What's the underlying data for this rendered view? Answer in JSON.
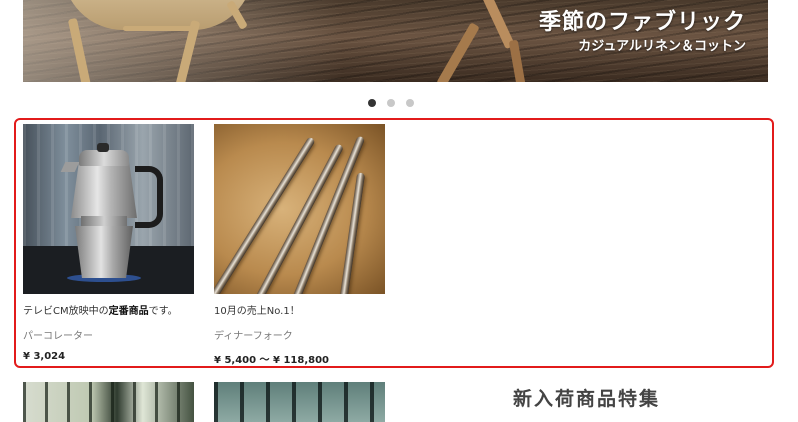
{
  "banner": {
    "title": "季節のファブリック",
    "subtitle": "カジュアルリネン＆コットン"
  },
  "carousel": {
    "slide_count": 3,
    "active_index": 0
  },
  "featured": {
    "products": [
      {
        "catch_plain": "テレビCM放映中の",
        "catch_bold": "定番商品",
        "catch_end": "です。",
        "name": "パーコレーター",
        "price": "¥ 3,024",
        "image_icon": "moka-pot-photo"
      },
      {
        "catch_plain": "10月の売上No.1！",
        "name": "ディナーフォーク",
        "price": "¥ 5,400 ～ ¥ 118,800",
        "image_icon": "dinner-fork-photo"
      }
    ]
  },
  "new_arrivals": {
    "heading": "新入荷商品特集"
  },
  "colors": {
    "highlight_border": "#e21b1b",
    "dot_active": "#333333",
    "dot_inactive": "#c8c8c8"
  }
}
